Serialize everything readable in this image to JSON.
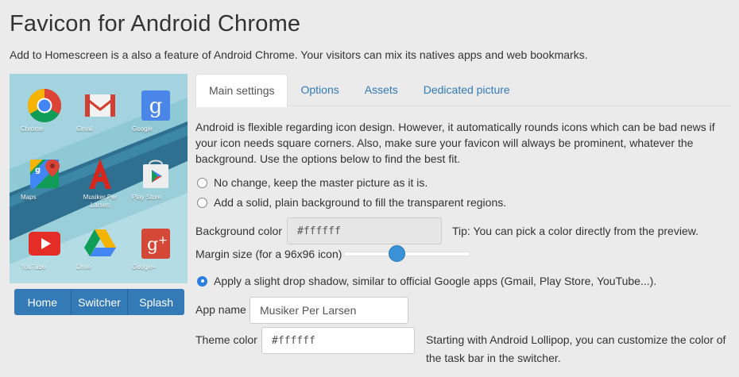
{
  "header": {
    "title": "Favicon for Android Chrome",
    "subtitle": "Add to Homescreen is a also a feature of Android Chrome. Your visitors can mix its natives apps and web bookmarks."
  },
  "preview": {
    "apps": [
      {
        "label": "Chrome",
        "icon": "chrome-icon"
      },
      {
        "label": "Gmail",
        "icon": "gmail-icon"
      },
      {
        "label": "Google",
        "icon": "google-search-icon"
      },
      {
        "label": "Maps",
        "icon": "maps-icon"
      },
      {
        "label": "Musiker Per Larsen",
        "icon": "musiker-per-larsen-icon"
      },
      {
        "label": "Play Store",
        "icon": "play-store-icon"
      },
      {
        "label": "YouTube",
        "icon": "youtube-icon"
      },
      {
        "label": "Drive",
        "icon": "drive-icon"
      },
      {
        "label": "Google+",
        "icon": "google-plus-icon"
      }
    ],
    "buttons": {
      "home": "Home",
      "switcher": "Switcher",
      "splash": "Splash"
    }
  },
  "tabs": [
    {
      "label": "Main settings",
      "active": true
    },
    {
      "label": "Options",
      "active": false
    },
    {
      "label": "Assets",
      "active": false
    },
    {
      "label": "Dedicated picture",
      "active": false
    }
  ],
  "main": {
    "description": "Android is flexible regarding icon design. However, it automatically rounds icons which can be bad news if your icon needs square corners. Also, make sure your favicon will always be prominent, whatever the background. Use the options below to find the best fit.",
    "option_no_change": "No change, keep the master picture as it is.",
    "option_background": "Add a solid, plain background to fill the transparent regions.",
    "background_color_label": "Background color",
    "background_color_value": "#ffffff",
    "background_tip": "Tip: You can pick a color directly from the preview.",
    "margin_label": "Margin size (for a 96x96 icon)",
    "margin_level": 0.42,
    "option_shadow": "Apply a slight drop shadow, similar to official Google apps (Gmail, Play Store, YouTube...).",
    "selected_option": "shadow",
    "app_name_label": "App name",
    "app_name_value": "Musiker Per Larsen",
    "theme_color_label": "Theme color",
    "theme_color_value": "#ffffff",
    "theme_color_note": "Starting with Android Lollipop, you can customize the color of the task bar in the switcher."
  },
  "colors": {
    "accent": "#337ab7",
    "radio_selected": "#2a7de1",
    "slider_thumb": "#3a93d8",
    "preview_background": "#8fc9d6"
  }
}
